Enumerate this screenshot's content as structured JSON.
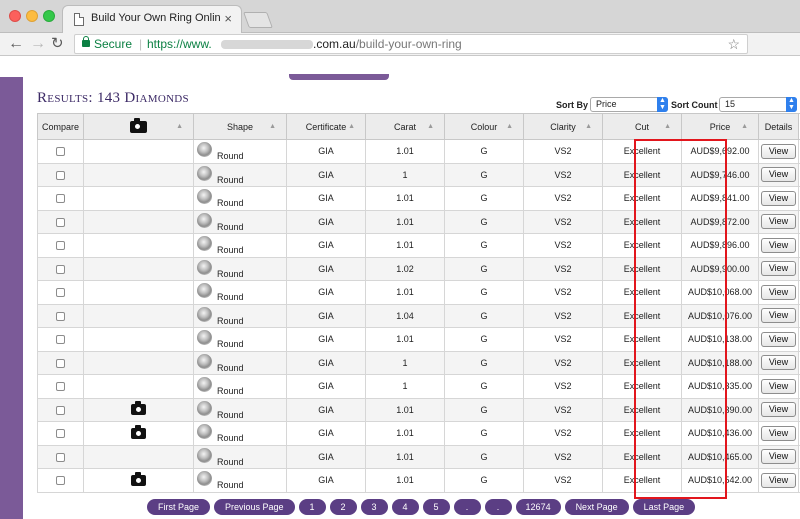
{
  "browser": {
    "tab_title": "Build Your Own Ring Online To",
    "tab_close": "×",
    "secure_label": "Secure",
    "url_scheme": "https://www.",
    "url_tld": ".com.au",
    "url_path": "/build-your-own-ring",
    "icons": [
      "page-icon",
      "back-arrow-icon",
      "forward-arrow-icon",
      "reload-icon",
      "lock-icon",
      "star-icon"
    ]
  },
  "results": {
    "title": "Results: 143 Diamonds"
  },
  "sort": {
    "sort_by_label": "Sort By",
    "sort_by_value": "Price",
    "sort_count_label": "Sort Count",
    "sort_count_value": "15"
  },
  "table": {
    "headers": {
      "compare": "Compare",
      "shape": "Shape",
      "certificate": "Certificate",
      "carat": "Carat",
      "colour": "Colour",
      "clarity": "Clarity",
      "cut": "Cut",
      "price": "Price",
      "details": "Details"
    },
    "rows": [
      {
        "photo": false,
        "shape": "Round",
        "certificate": "GIA",
        "carat": "1.01",
        "colour": "G",
        "clarity": "VS2",
        "cut": "Excellent",
        "price": "AUD$9,692.00",
        "details": "View"
      },
      {
        "photo": false,
        "shape": "Round",
        "certificate": "GIA",
        "carat": "1",
        "colour": "G",
        "clarity": "VS2",
        "cut": "Excellent",
        "price": "AUD$9,746.00",
        "details": "View"
      },
      {
        "photo": false,
        "shape": "Round",
        "certificate": "GIA",
        "carat": "1.01",
        "colour": "G",
        "clarity": "VS2",
        "cut": "Excellent",
        "price": "AUD$9,841.00",
        "details": "View"
      },
      {
        "photo": false,
        "shape": "Round",
        "certificate": "GIA",
        "carat": "1.01",
        "colour": "G",
        "clarity": "VS2",
        "cut": "Excellent",
        "price": "AUD$9,872.00",
        "details": "View"
      },
      {
        "photo": false,
        "shape": "Round",
        "certificate": "GIA",
        "carat": "1.01",
        "colour": "G",
        "clarity": "VS2",
        "cut": "Excellent",
        "price": "AUD$9,896.00",
        "details": "View"
      },
      {
        "photo": false,
        "shape": "Round",
        "certificate": "GIA",
        "carat": "1.02",
        "colour": "G",
        "clarity": "VS2",
        "cut": "Excellent",
        "price": "AUD$9,900.00",
        "details": "View"
      },
      {
        "photo": false,
        "shape": "Round",
        "certificate": "GIA",
        "carat": "1.01",
        "colour": "G",
        "clarity": "VS2",
        "cut": "Excellent",
        "price": "AUD$10,068.00",
        "details": "View"
      },
      {
        "photo": false,
        "shape": "Round",
        "certificate": "GIA",
        "carat": "1.04",
        "colour": "G",
        "clarity": "VS2",
        "cut": "Excellent",
        "price": "AUD$10,076.00",
        "details": "View"
      },
      {
        "photo": false,
        "shape": "Round",
        "certificate": "GIA",
        "carat": "1.01",
        "colour": "G",
        "clarity": "VS2",
        "cut": "Excellent",
        "price": "AUD$10,138.00",
        "details": "View"
      },
      {
        "photo": false,
        "shape": "Round",
        "certificate": "GIA",
        "carat": "1",
        "colour": "G",
        "clarity": "VS2",
        "cut": "Excellent",
        "price": "AUD$10,188.00",
        "details": "View"
      },
      {
        "photo": false,
        "shape": "Round",
        "certificate": "GIA",
        "carat": "1",
        "colour": "G",
        "clarity": "VS2",
        "cut": "Excellent",
        "price": "AUD$10,335.00",
        "details": "View"
      },
      {
        "photo": true,
        "shape": "Round",
        "certificate": "GIA",
        "carat": "1.01",
        "colour": "G",
        "clarity": "VS2",
        "cut": "Excellent",
        "price": "AUD$10,390.00",
        "details": "View"
      },
      {
        "photo": true,
        "shape": "Round",
        "certificate": "GIA",
        "carat": "1.01",
        "colour": "G",
        "clarity": "VS2",
        "cut": "Excellent",
        "price": "AUD$10,436.00",
        "details": "View"
      },
      {
        "photo": false,
        "shape": "Round",
        "certificate": "GIA",
        "carat": "1.01",
        "colour": "G",
        "clarity": "VS2",
        "cut": "Excellent",
        "price": "AUD$10,465.00",
        "details": "View"
      },
      {
        "photo": true,
        "shape": "Round",
        "certificate": "GIA",
        "carat": "1.01",
        "colour": "G",
        "clarity": "VS2",
        "cut": "Excellent",
        "price": "AUD$10,542.00",
        "details": "View"
      }
    ]
  },
  "pagination": [
    {
      "label": "First Page",
      "kind": "text"
    },
    {
      "label": "Previous Page",
      "kind": "text"
    },
    {
      "label": "1",
      "kind": "num"
    },
    {
      "label": "2",
      "kind": "num"
    },
    {
      "label": "3",
      "kind": "num"
    },
    {
      "label": "4",
      "kind": "num"
    },
    {
      "label": "5",
      "kind": "num"
    },
    {
      "label": ".",
      "kind": "num"
    },
    {
      "label": ".",
      "kind": "num"
    },
    {
      "label": "12674",
      "kind": "wide"
    },
    {
      "label": "Next Page",
      "kind": "text"
    },
    {
      "label": "Last Page",
      "kind": "text"
    }
  ],
  "colors": {
    "brand_purple": "#7b5a98",
    "pager_purple": "#5b3e84",
    "title_color": "#3c2a66",
    "highlight_red": "#e2161d",
    "secure_green": "#0b8043"
  }
}
